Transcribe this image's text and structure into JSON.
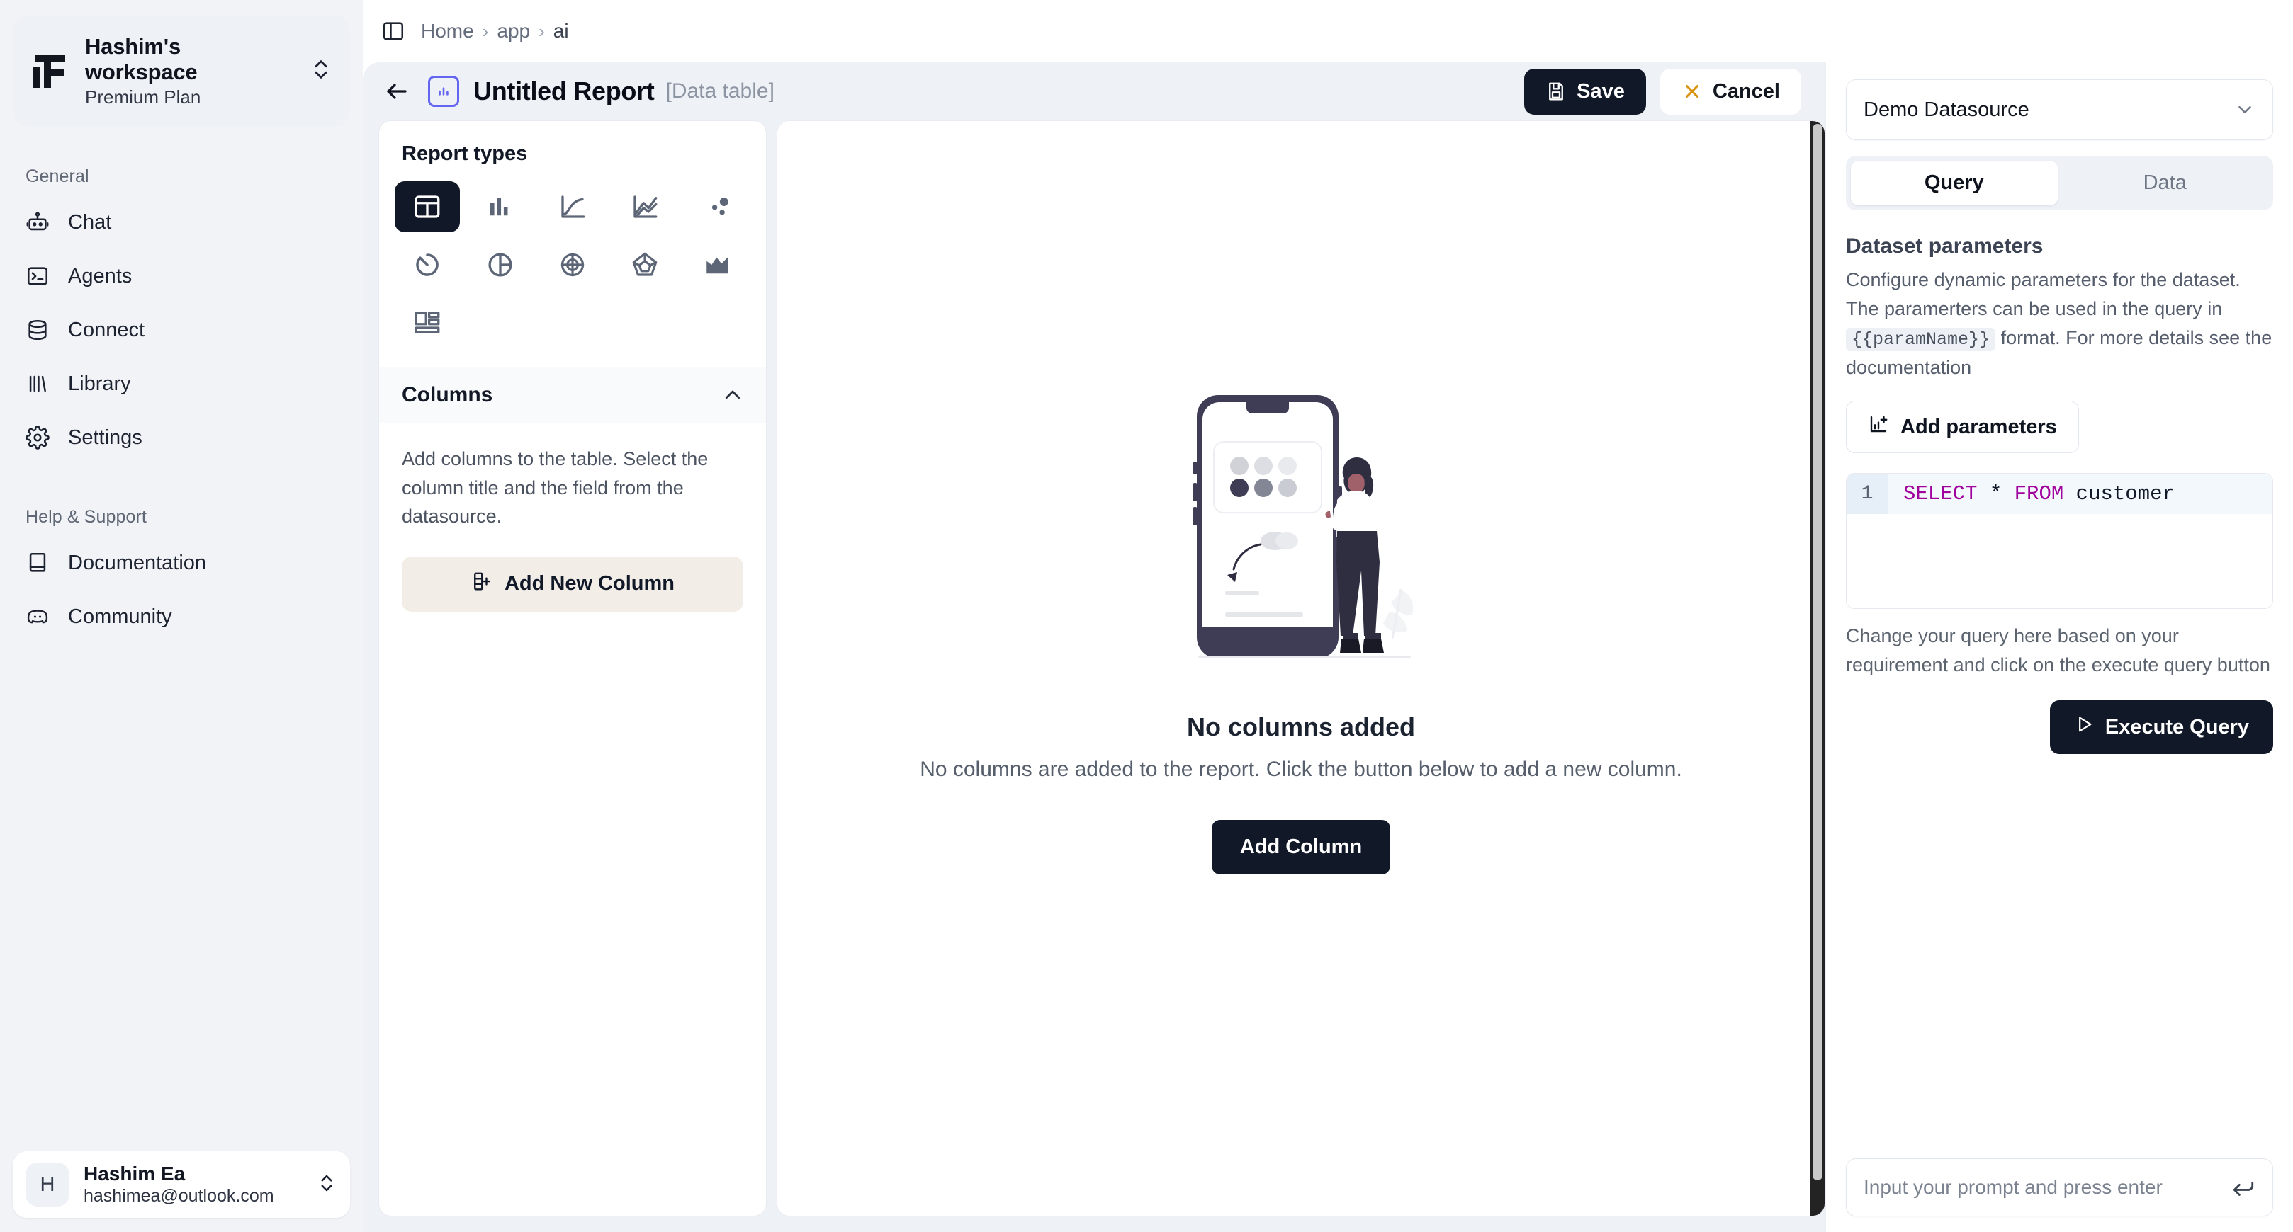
{
  "sidebar": {
    "workspace": {
      "name": "Hashim's workspace",
      "plan": "Premium Plan"
    },
    "groups": [
      {
        "title": "General",
        "items": [
          {
            "label": "Chat",
            "icon": "bot-icon"
          },
          {
            "label": "Agents",
            "icon": "terminal-icon"
          },
          {
            "label": "Connect",
            "icon": "database-icon"
          },
          {
            "label": "Library",
            "icon": "library-icon"
          },
          {
            "label": "Settings",
            "icon": "gear-icon"
          }
        ]
      },
      {
        "title": "Help & Support",
        "items": [
          {
            "label": "Documentation",
            "icon": "book-icon"
          },
          {
            "label": "Community",
            "icon": "discord-icon"
          }
        ]
      }
    ],
    "user": {
      "initial": "H",
      "name": "Hashim Ea",
      "email": "hashimea@outlook.com"
    }
  },
  "topbar": {
    "breadcrumbs": [
      {
        "label": "Home"
      },
      {
        "label": "app"
      },
      {
        "label": "ai"
      }
    ],
    "separator": "›"
  },
  "report_header": {
    "title": "Untitled Report",
    "subtitle": "[Data table]",
    "save_label": "Save",
    "cancel_label": "Cancel",
    "cancel_icon_color": "#d9920c"
  },
  "left_panel": {
    "report_types_title": "Report types",
    "report_types": [
      {
        "name": "data-table",
        "active": true
      },
      {
        "name": "bar-chart",
        "active": false
      },
      {
        "name": "line-chart",
        "active": false
      },
      {
        "name": "area-line-chart",
        "active": false
      },
      {
        "name": "scatter-chart",
        "active": false
      },
      {
        "name": "gauge-chart",
        "active": false
      },
      {
        "name": "pie-chart",
        "active": false
      },
      {
        "name": "polar-chart",
        "active": false
      },
      {
        "name": "radar-chart",
        "active": false
      },
      {
        "name": "area-chart",
        "active": false
      },
      {
        "name": "card-layout",
        "active": false
      }
    ],
    "columns_title": "Columns",
    "columns_desc": "Add columns to the table. Select the column title and the field from the datasource.",
    "add_new_column_label": "Add New Column"
  },
  "canvas": {
    "empty_title": "No columns added",
    "empty_desc": "No columns are added to the report. Click the button below to add a new column.",
    "add_column_label": "Add Column"
  },
  "right_panel": {
    "datasource": "Demo Datasource",
    "tabs": [
      {
        "label": "Query",
        "active": true
      },
      {
        "label": "Data",
        "active": false
      }
    ],
    "dataset_params_title": "Dataset parameters",
    "dataset_params_desc_1": "Configure dynamic parameters for the dataset. The paramerters can be used in the query in",
    "dataset_params_code": "{{paramName}}",
    "dataset_params_desc_2": "format. For more details see the documentation",
    "add_parameters_label": "Add parameters",
    "sql": {
      "line_number": "1",
      "keyword_1": "SELECT",
      "star": "*",
      "keyword_2": "FROM",
      "table": "customer",
      "full": "SELECT * FROM customer"
    },
    "sql_hint": "Change your query here based on your requirement and click on the execute query button",
    "execute_label": "Execute Query",
    "prompt_placeholder": "Input your prompt and press enter"
  },
  "scrollbar": {
    "position": "right-edge-canvas"
  }
}
